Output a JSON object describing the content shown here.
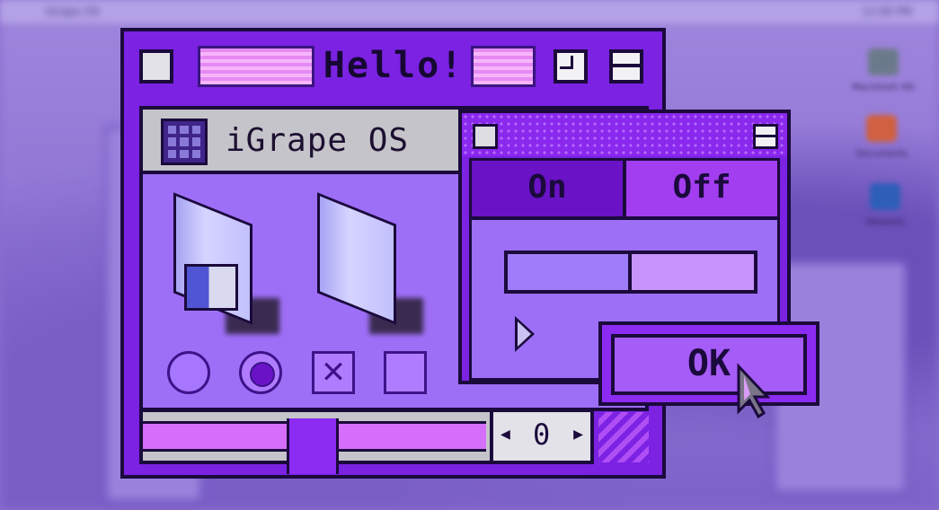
{
  "desktop": {
    "menubar_title": "iGrape OS",
    "menubar_clock": "12:00 PM",
    "icons": [
      {
        "label": "Macintosh HD",
        "icon": "hard-drive-icon",
        "color": "#6b7a8a"
      },
      {
        "label": "Documents",
        "icon": "document-icon",
        "color": "#d06040"
      },
      {
        "label": "Network",
        "icon": "network-icon",
        "color": "#2d5fb8"
      }
    ]
  },
  "main_window": {
    "title": "Hello!",
    "app_name": "iGrape OS",
    "folders": [
      {
        "name": "finder-folder",
        "icon": "finder-folder-icon"
      },
      {
        "name": "empty-folder",
        "icon": "folder-icon"
      }
    ],
    "controls": {
      "radio_unselected": false,
      "radio_selected": true,
      "checkbox_checked": true,
      "checkbox_unchecked": false
    },
    "scroll": {
      "position": 0.42,
      "stepper_value": "0"
    }
  },
  "toggle_dialog": {
    "on_label": "On",
    "off_label": "Off",
    "selected": "Off",
    "slider_level": 0.5
  },
  "ok_button": {
    "label": "OK"
  },
  "colors": {
    "window_purple": "#7b22e3",
    "panel_lavender": "#9d6ff7",
    "outline": "#1b0a3c",
    "title_stripes": "#e58af3",
    "titlebar_gray": "#c4c4ca"
  }
}
